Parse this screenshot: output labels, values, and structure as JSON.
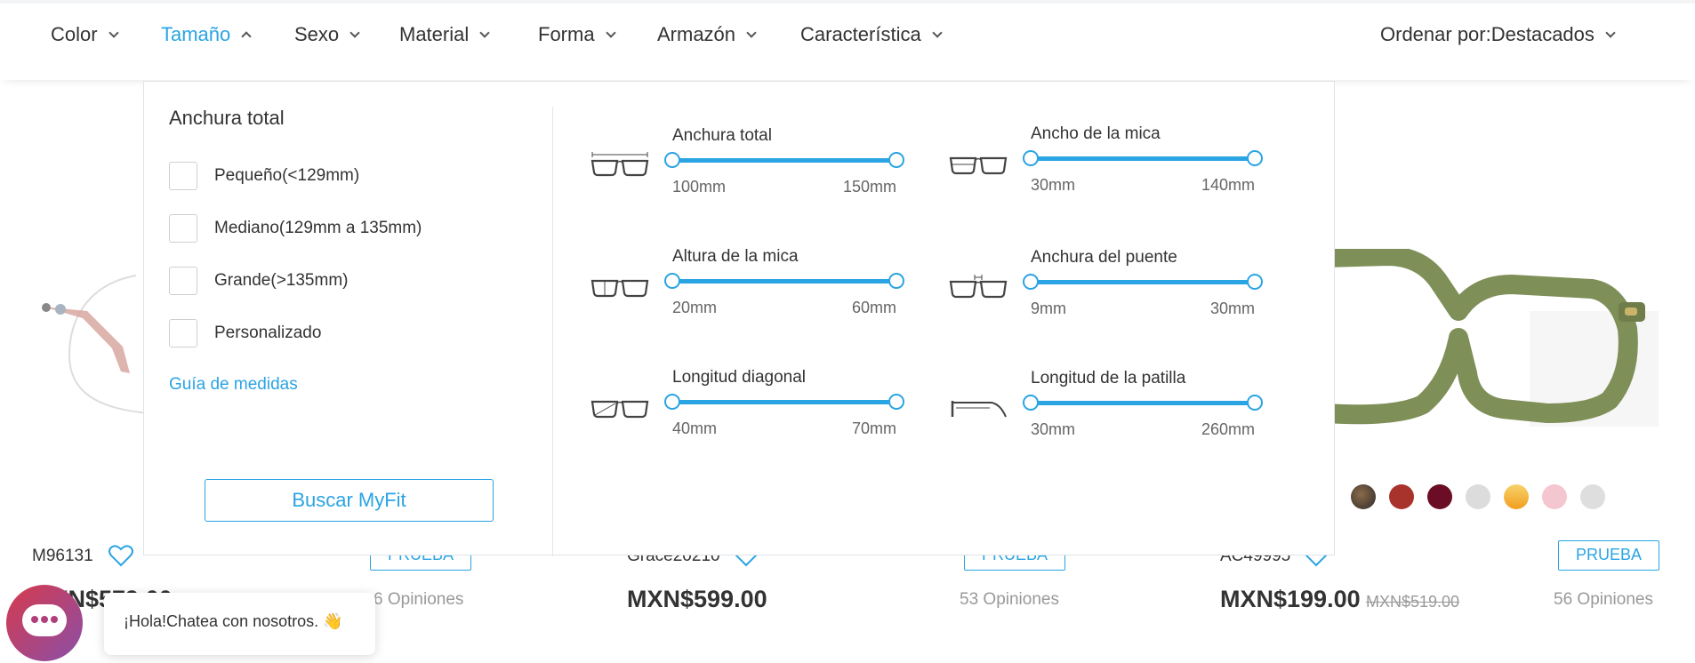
{
  "filters": [
    {
      "label": "Color",
      "active": false
    },
    {
      "label": "Tamaño",
      "active": true
    },
    {
      "label": "Sexo",
      "active": false
    },
    {
      "label": "Material",
      "active": false
    },
    {
      "label": "Forma",
      "active": false
    },
    {
      "label": "Armazón",
      "active": false
    },
    {
      "label": "Característica",
      "active": false
    }
  ],
  "sort": {
    "label": "Ordenar por:Destacados"
  },
  "panel": {
    "left_title": "Anchura total",
    "options": [
      "Pequeño(<129mm)",
      "Mediano(129mm a 135mm)",
      "Grande(>135mm)",
      "Personalizado"
    ],
    "guide_link": "Guía de medidas",
    "myfit_button": "Buscar MyFit",
    "sliders": [
      {
        "label": "Anchura total",
        "min": "100mm",
        "max": "150mm",
        "icon": "frame-width-icon"
      },
      {
        "label": "Ancho de la mica",
        "min": "30mm",
        "max": "140mm",
        "icon": "lens-width-icon"
      },
      {
        "label": "Altura de la mica",
        "min": "20mm",
        "max": "60mm",
        "icon": "lens-height-icon"
      },
      {
        "label": "Anchura del puente",
        "min": "9mm",
        "max": "30mm",
        "icon": "bridge-width-icon"
      },
      {
        "label": "Longitud diagonal",
        "min": "40mm",
        "max": "70mm",
        "icon": "diagonal-length-icon"
      },
      {
        "label": "Longitud de la patilla",
        "min": "30mm",
        "max": "260mm",
        "icon": "temple-length-icon"
      }
    ]
  },
  "products": [
    {
      "sku": "M96131",
      "price": "MXN$579.00",
      "reviews": "6 Opiniones",
      "try_label": "PRUEBA"
    },
    {
      "sku": "Grace20210",
      "price": "MXN$599.00",
      "reviews": "53 Opiniones",
      "try_label": "PRUEBA"
    },
    {
      "sku": "AC49995",
      "price": "MXN$199.00",
      "old_price": "MXN$519.00",
      "reviews": "56 Opiniones",
      "try_label": "PRUEBA"
    }
  ],
  "swatch_colors": [
    "#222222",
    "#5a4a3a",
    "#a8322c",
    "#6b0d24",
    "#dcdcdc",
    "#f2b33d",
    "#f4c6cf",
    "#dedede"
  ],
  "accent_color": "#2aa4e3",
  "chat": {
    "popup_text": "¡Hola!Chatea con nosotros. 👋",
    "icon": "chat-icon"
  }
}
